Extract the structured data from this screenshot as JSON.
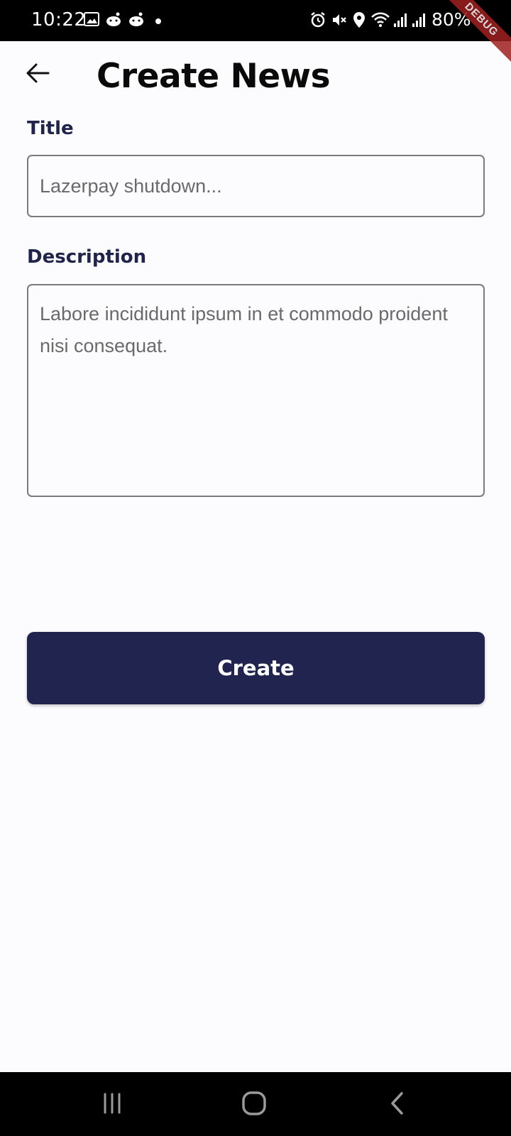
{
  "status_bar": {
    "time": "10:22",
    "battery": "80%",
    "debug_label": "DEBUG",
    "icons": [
      "image-icon",
      "reddit-icon",
      "reddit-icon",
      "dot-icon",
      "alarm-icon",
      "mute-icon",
      "location-icon",
      "wifi-icon",
      "signal-icon",
      "signal-icon",
      "battery-icon"
    ]
  },
  "app_bar": {
    "title": "Create News",
    "back_icon": "arrow-left-icon"
  },
  "form": {
    "title_label": "Title",
    "title_placeholder": "Lazerpay shutdown...",
    "description_label": "Description",
    "description_placeholder": "Labore incididunt ipsum in et commodo proident nisi consequat.",
    "submit_label": "Create"
  },
  "nav_bar": {
    "icons": [
      "recents-icon",
      "home-icon",
      "back-icon"
    ]
  },
  "colors": {
    "primary": "#20244e",
    "label": "#20244a",
    "background": "#fcfcff",
    "border": "#7a7a7a"
  }
}
